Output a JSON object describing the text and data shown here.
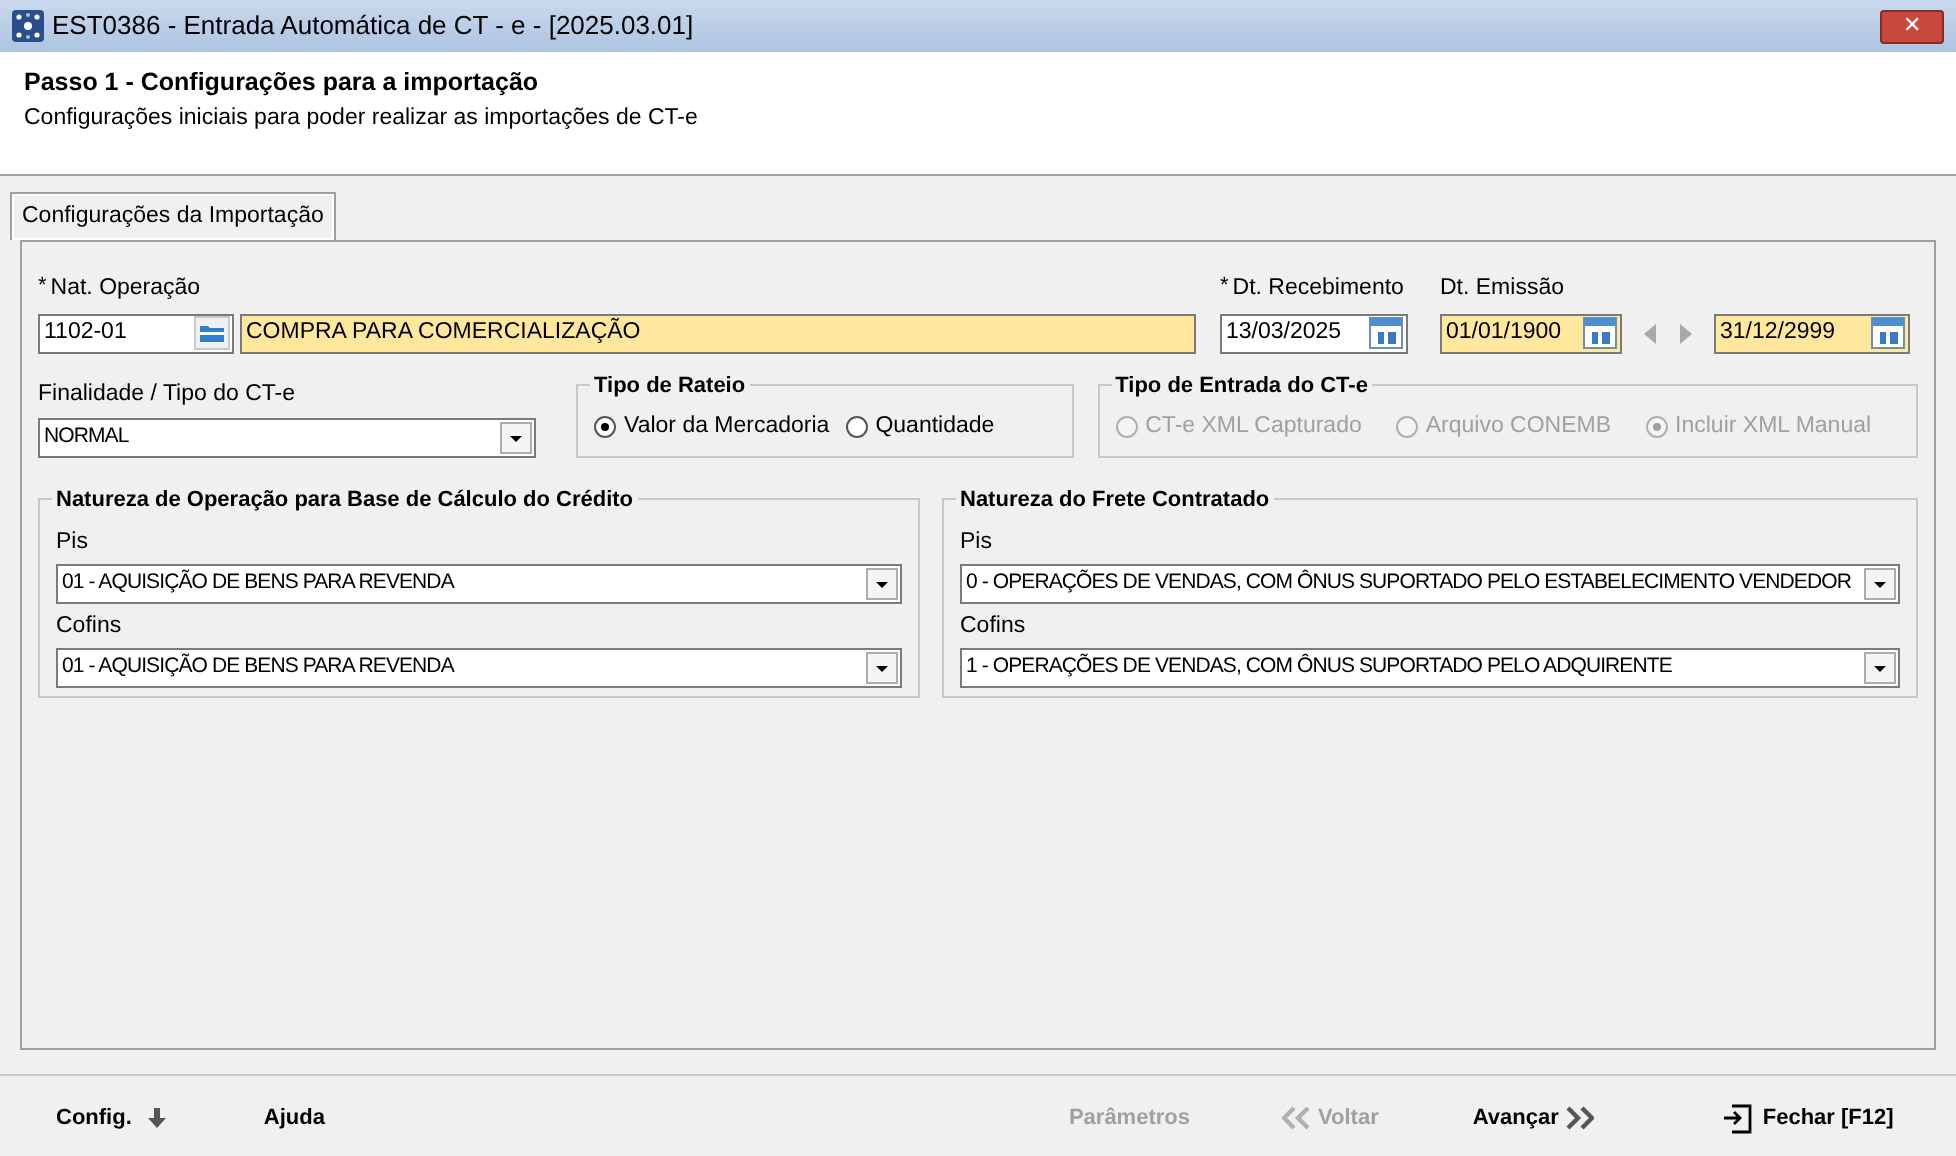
{
  "window": {
    "title": "EST0386 - Entrada Automática de CT - e - [2025.03.01]",
    "close": "✕"
  },
  "header": {
    "title": "Passo 1 - Configurações para a importação",
    "subtitle": "Configurações iniciais para poder realizar as importações de CT-e"
  },
  "tabs": [
    {
      "label": "Configurações da Importação",
      "selected": true
    }
  ],
  "nat_operacao": {
    "required_mark": "*",
    "label": "Nat. Operação",
    "code": "1102-01",
    "description": "COMPRA PARA COMERCIALIZAÇÃO"
  },
  "dt_recebimento": {
    "required_mark": "*",
    "label": "Dt. Recebimento",
    "value": "13/03/2025"
  },
  "dt_emissao": {
    "label": "Dt. Emissão",
    "from": "01/01/1900",
    "to": "31/12/2999"
  },
  "finalidade": {
    "label": "Finalidade / Tipo do CT-e",
    "value": "NORMAL"
  },
  "tipo_rateio": {
    "title": "Tipo de Rateio",
    "options": [
      {
        "label": "Valor da Mercadoria",
        "selected": true,
        "disabled": false
      },
      {
        "label": "Quantidade",
        "selected": false,
        "disabled": false
      }
    ]
  },
  "tipo_entrada": {
    "title": "Tipo de Entrada do CT-e",
    "options": [
      {
        "label": "CT-e XML Capturado",
        "selected": false,
        "disabled": true
      },
      {
        "label": "Arquivo CONEMB",
        "selected": false,
        "disabled": true
      },
      {
        "label": "Incluir XML Manual",
        "selected": true,
        "disabled": true
      }
    ]
  },
  "groups": [
    {
      "title": "Natureza de Operação para Base de Cálculo do Crédito",
      "rows": [
        {
          "label": "Pis",
          "value": "01 - AQUISIÇÃO DE BENS PARA REVENDA"
        },
        {
          "label": "Cofins",
          "value": "01 - AQUISIÇÃO DE BENS PARA REVENDA"
        }
      ]
    },
    {
      "title": "Natureza do Frete Contratado",
      "rows": [
        {
          "label": "Pis",
          "value": "0 - OPERAÇÕES DE VENDAS, COM ÔNUS SUPORTADO PELO ESTABELECIMENTO VENDEDOR"
        },
        {
          "label": "Cofins",
          "value": "1 - OPERAÇÕES DE VENDAS, COM ÔNUS SUPORTADO PELO ADQUIRENTE"
        }
      ]
    }
  ],
  "footer": [
    {
      "label": "Config.",
      "kind": "config",
      "disabled": false
    },
    {
      "label": "Ajuda",
      "kind": "plain",
      "disabled": false
    },
    {
      "label": "Parâmetros",
      "kind": "plain",
      "disabled": true
    },
    {
      "label": "Voltar",
      "kind": "back",
      "disabled": true
    },
    {
      "label": "Avançar",
      "kind": "next",
      "disabled": false
    },
    {
      "label": "Fechar [F12]",
      "kind": "close",
      "disabled": false
    }
  ]
}
